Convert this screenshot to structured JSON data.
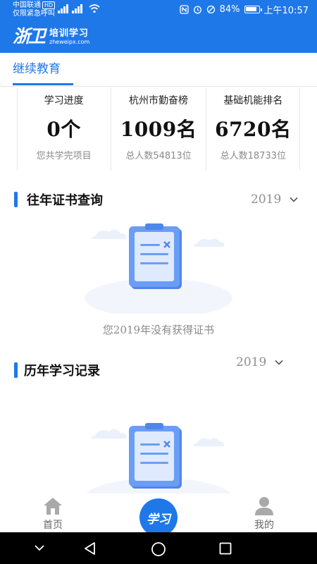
{
  "status_bar": {
    "carrier": "中国联通",
    "carrier_badge": "HD",
    "emergency": "仅限紧急呼叫",
    "signal_label": "4G",
    "battery": "84%",
    "time": "上午10:57"
  },
  "header": {
    "logo_mark": "浙卫",
    "title": "培训学习",
    "url": "zheweipx.com"
  },
  "tabs": [
    {
      "label": "继续教育",
      "active": true
    }
  ],
  "stats": [
    {
      "label": "学习进度",
      "value": "0个",
      "sub": "您共学完项目"
    },
    {
      "label": "杭州市勤奋榜",
      "value": "1009名",
      "sub": "总人数54813位"
    },
    {
      "label": "基础机能排名",
      "value": "6720名",
      "sub": "总人数18733位"
    }
  ],
  "sections": [
    {
      "title": "往年证书查询",
      "year": "2019",
      "empty_text": "您2019年没有获得证书"
    },
    {
      "title": "历年学习记录",
      "year": "2019",
      "empty_text": ""
    }
  ],
  "bottom_nav": {
    "home": "首页",
    "center": "学习",
    "mine": "我的"
  },
  "colors": {
    "brand": "#1f78e8",
    "illustration": "#5b8ef0"
  }
}
